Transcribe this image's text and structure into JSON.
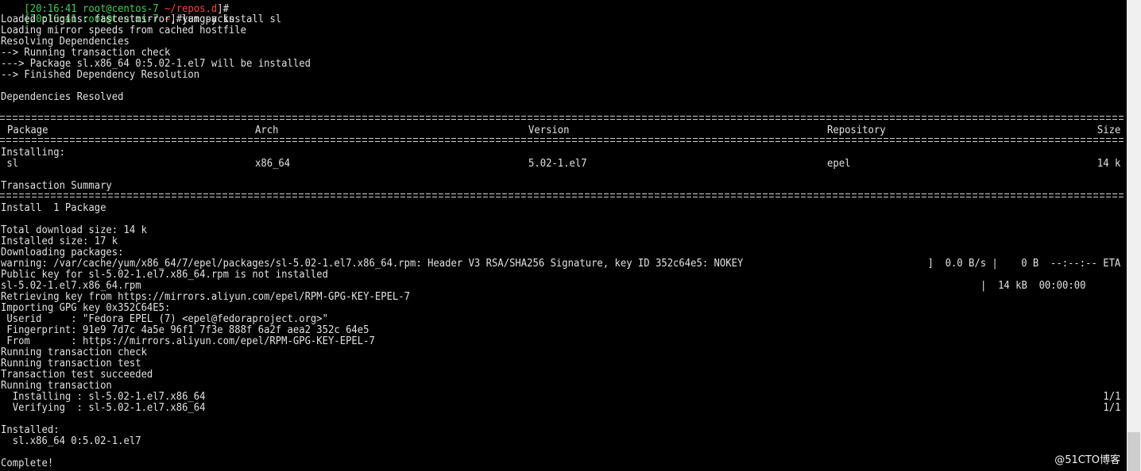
{
  "terminal": {
    "prompt": {
      "time": "[20:16:41",
      "user_host": "root@centos-7",
      "cwd": "~",
      "suffix": "]#",
      "command": "yum -y install sl"
    },
    "output_top": [
      "Loaded plugins: fastestmirror, langpacks",
      "Loading mirror speeds from cached hostfile",
      "Resolving Dependencies",
      "--> Running transaction check",
      "---> Package sl.x86_64 0:5.02-1.el7 will be installed",
      "--> Finished Dependency Resolution",
      "Dependencies Resolved"
    ],
    "table": {
      "headers": {
        "package": "Package",
        "arch": "Arch",
        "version": "Version",
        "repository": "Repository",
        "size": "Size"
      },
      "section_label": "Installing:",
      "row": {
        "package": " sl",
        "arch": "x86_64",
        "version": "5.02-1.el7",
        "repository": "epel",
        "size": "14 k"
      }
    },
    "transaction_summary": "Transaction Summary",
    "install_count": "Install  1 Package",
    "sizes": [
      "Total download size: 14 k",
      "Installed size: 17 k",
      "Downloading packages:"
    ],
    "warning": {
      "text": "warning: /var/cache/yum/x86_64/7/epel/packages/sl-5.02-1.el7.x86_64.rpm: Header V3 RSA/SHA256 Signature, key ID 352c64e5: NOKEY",
      "progress": "]  0.0 B/s |    0 B  --:--:-- ETA"
    },
    "public_key": "Public key for sl-5.02-1.el7.x86_64.rpm is not installed",
    "rpm_line": {
      "name": "sl-5.02-1.el7.x86_64.rpm",
      "progress": "|  14 kB  00:00:00"
    },
    "gpg": [
      "Retrieving key from https://mirrors.aliyun.com/epel/RPM-GPG-KEY-EPEL-7",
      "Importing GPG key 0x352C64E5:",
      " Userid     : \"Fedora EPEL (7) <epel@fedoraproject.org>\"",
      " Fingerprint: 91e9 7d7c 4a5e 96f1 7f3e 888f 6a2f aea2 352c 64e5",
      " From       : https://mirrors.aliyun.com/epel/RPM-GPG-KEY-EPEL-7",
      "Running transaction check",
      "Running transaction test",
      "Transaction test succeeded",
      "Running transaction"
    ],
    "steps": [
      {
        "label": "  Installing : sl-5.02-1.el7.x86_64",
        "count": "1/1"
      },
      {
        "label": "  Verifying  : sl-5.02-1.el7.x86_64",
        "count": "1/1"
      }
    ],
    "installed_label": "Installed:",
    "installed_pkg": "  sl.x86_64 0:5.02-1.el7",
    "complete": "Complete!"
  },
  "watermark": "@51CTO博客",
  "colors": {
    "background": "#000000",
    "text": "#e0e0e0",
    "prompt_green": "#3fd14f",
    "prompt_red": "#ff4040"
  }
}
